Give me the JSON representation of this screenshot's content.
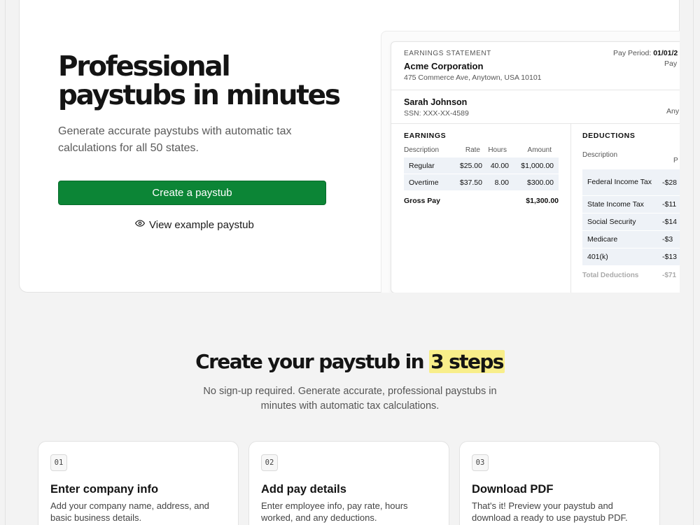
{
  "hero": {
    "title": "Professional paystubs in minutes",
    "subtitle": "Generate accurate paystubs with automatic tax calculations for all 50 states.",
    "cta_label": "Create a paystub",
    "view_example_label": "View example paystub",
    "view_example_icon": "eye-icon",
    "accent_color": "#0c8536"
  },
  "paystub": {
    "statement_label": "EARNINGS STATEMENT",
    "company_name": "Acme Corporation",
    "company_address": "475 Commerce Ave, Anytown, USA 10101",
    "pay_period_label": "Pay Period:",
    "pay_period_value": "01/01/2",
    "pay_period_sub": "Pay",
    "employee_name": "Sarah Johnson",
    "employee_ssn": "SSN: XXX-XX-4589",
    "employee_right": "Any",
    "earnings": {
      "title": "EARNINGS",
      "headers": {
        "description": "Description",
        "rate": "Rate",
        "hours": "Hours",
        "amount": "Amount"
      },
      "rows": [
        {
          "description": "Regular",
          "rate": "$25.00",
          "hours": "40.00",
          "amount": "$1,000.00"
        },
        {
          "description": "Overtime",
          "rate": "$37.50",
          "hours": "8.00",
          "amount": "$300.00"
        }
      ],
      "gross_label": "Gross Pay",
      "gross_value": "$1,300.00"
    },
    "deductions": {
      "title": "DEDUCTIONS",
      "header_description": "Description",
      "header_partial": "P",
      "rows": [
        {
          "description": "Federal Income Tax",
          "amount": "-$28"
        },
        {
          "description": "State Income Tax",
          "amount": "-$11"
        },
        {
          "description": "Social Security",
          "amount": "-$14"
        },
        {
          "description": "Medicare",
          "amount": "-$3"
        },
        {
          "description": "401(k)",
          "amount": "-$13"
        }
      ],
      "total_label": "Total Deductions",
      "total_value": "-$71"
    }
  },
  "steps_section": {
    "title_prefix": "Create your paystub in",
    "title_highlight": "3 steps",
    "subtitle": "No sign-up required. Generate accurate, professional paystubs in minutes with automatic tax calculations.",
    "highlight_color": "#f8ee8a",
    "steps": [
      {
        "number": "01",
        "title": "Enter company info",
        "description": "Add your company name, address, and basic business details."
      },
      {
        "number": "02",
        "title": "Add pay details",
        "description": "Enter employee info, pay rate, hours worked, and any deductions."
      },
      {
        "number": "03",
        "title": "Download PDF",
        "description": "That's it! Preview your paystub and download a ready to use paystub PDF."
      }
    ]
  }
}
